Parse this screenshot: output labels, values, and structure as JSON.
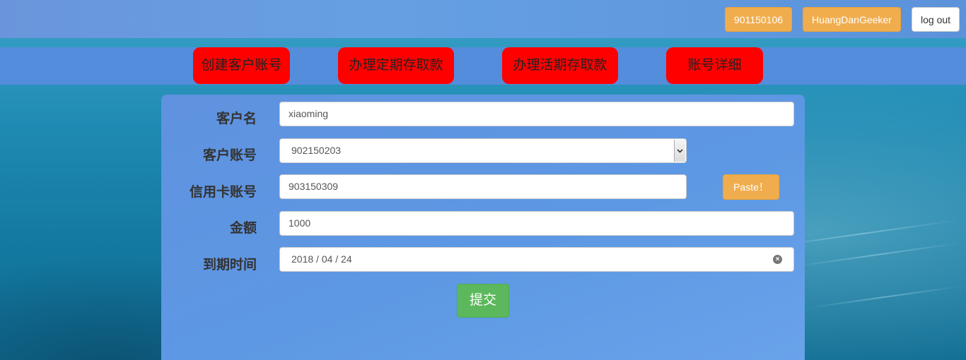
{
  "topbar": {
    "account_id": "901150106",
    "username": "HuangDanGeeker",
    "logout_label": "log out"
  },
  "nav": {
    "items": [
      {
        "label": "创建客户账号"
      },
      {
        "label": "办理定期存取款"
      },
      {
        "label": "办理活期存取款"
      },
      {
        "label": "账号详细"
      }
    ]
  },
  "form": {
    "customer_name": {
      "label": "客户名",
      "value": "xiaoming"
    },
    "customer_account": {
      "label": "客户账号",
      "selected": "902150203"
    },
    "credit_card": {
      "label": "信用卡账号",
      "value": "903150309",
      "paste_label": "Paste！"
    },
    "amount": {
      "label": "金额",
      "value": "1000"
    },
    "due_date": {
      "label": "到期时间",
      "value": "2018 / 04 / 24"
    },
    "submit_label": "提交"
  },
  "colors": {
    "accent_orange": "#f0ad4e",
    "nav_button_red": "#ff0000",
    "submit_green": "#5cb85c",
    "panel_blue": "#5d98e4"
  },
  "icons": {
    "select": "chevron-down-icon",
    "clear": "clear-icon"
  }
}
